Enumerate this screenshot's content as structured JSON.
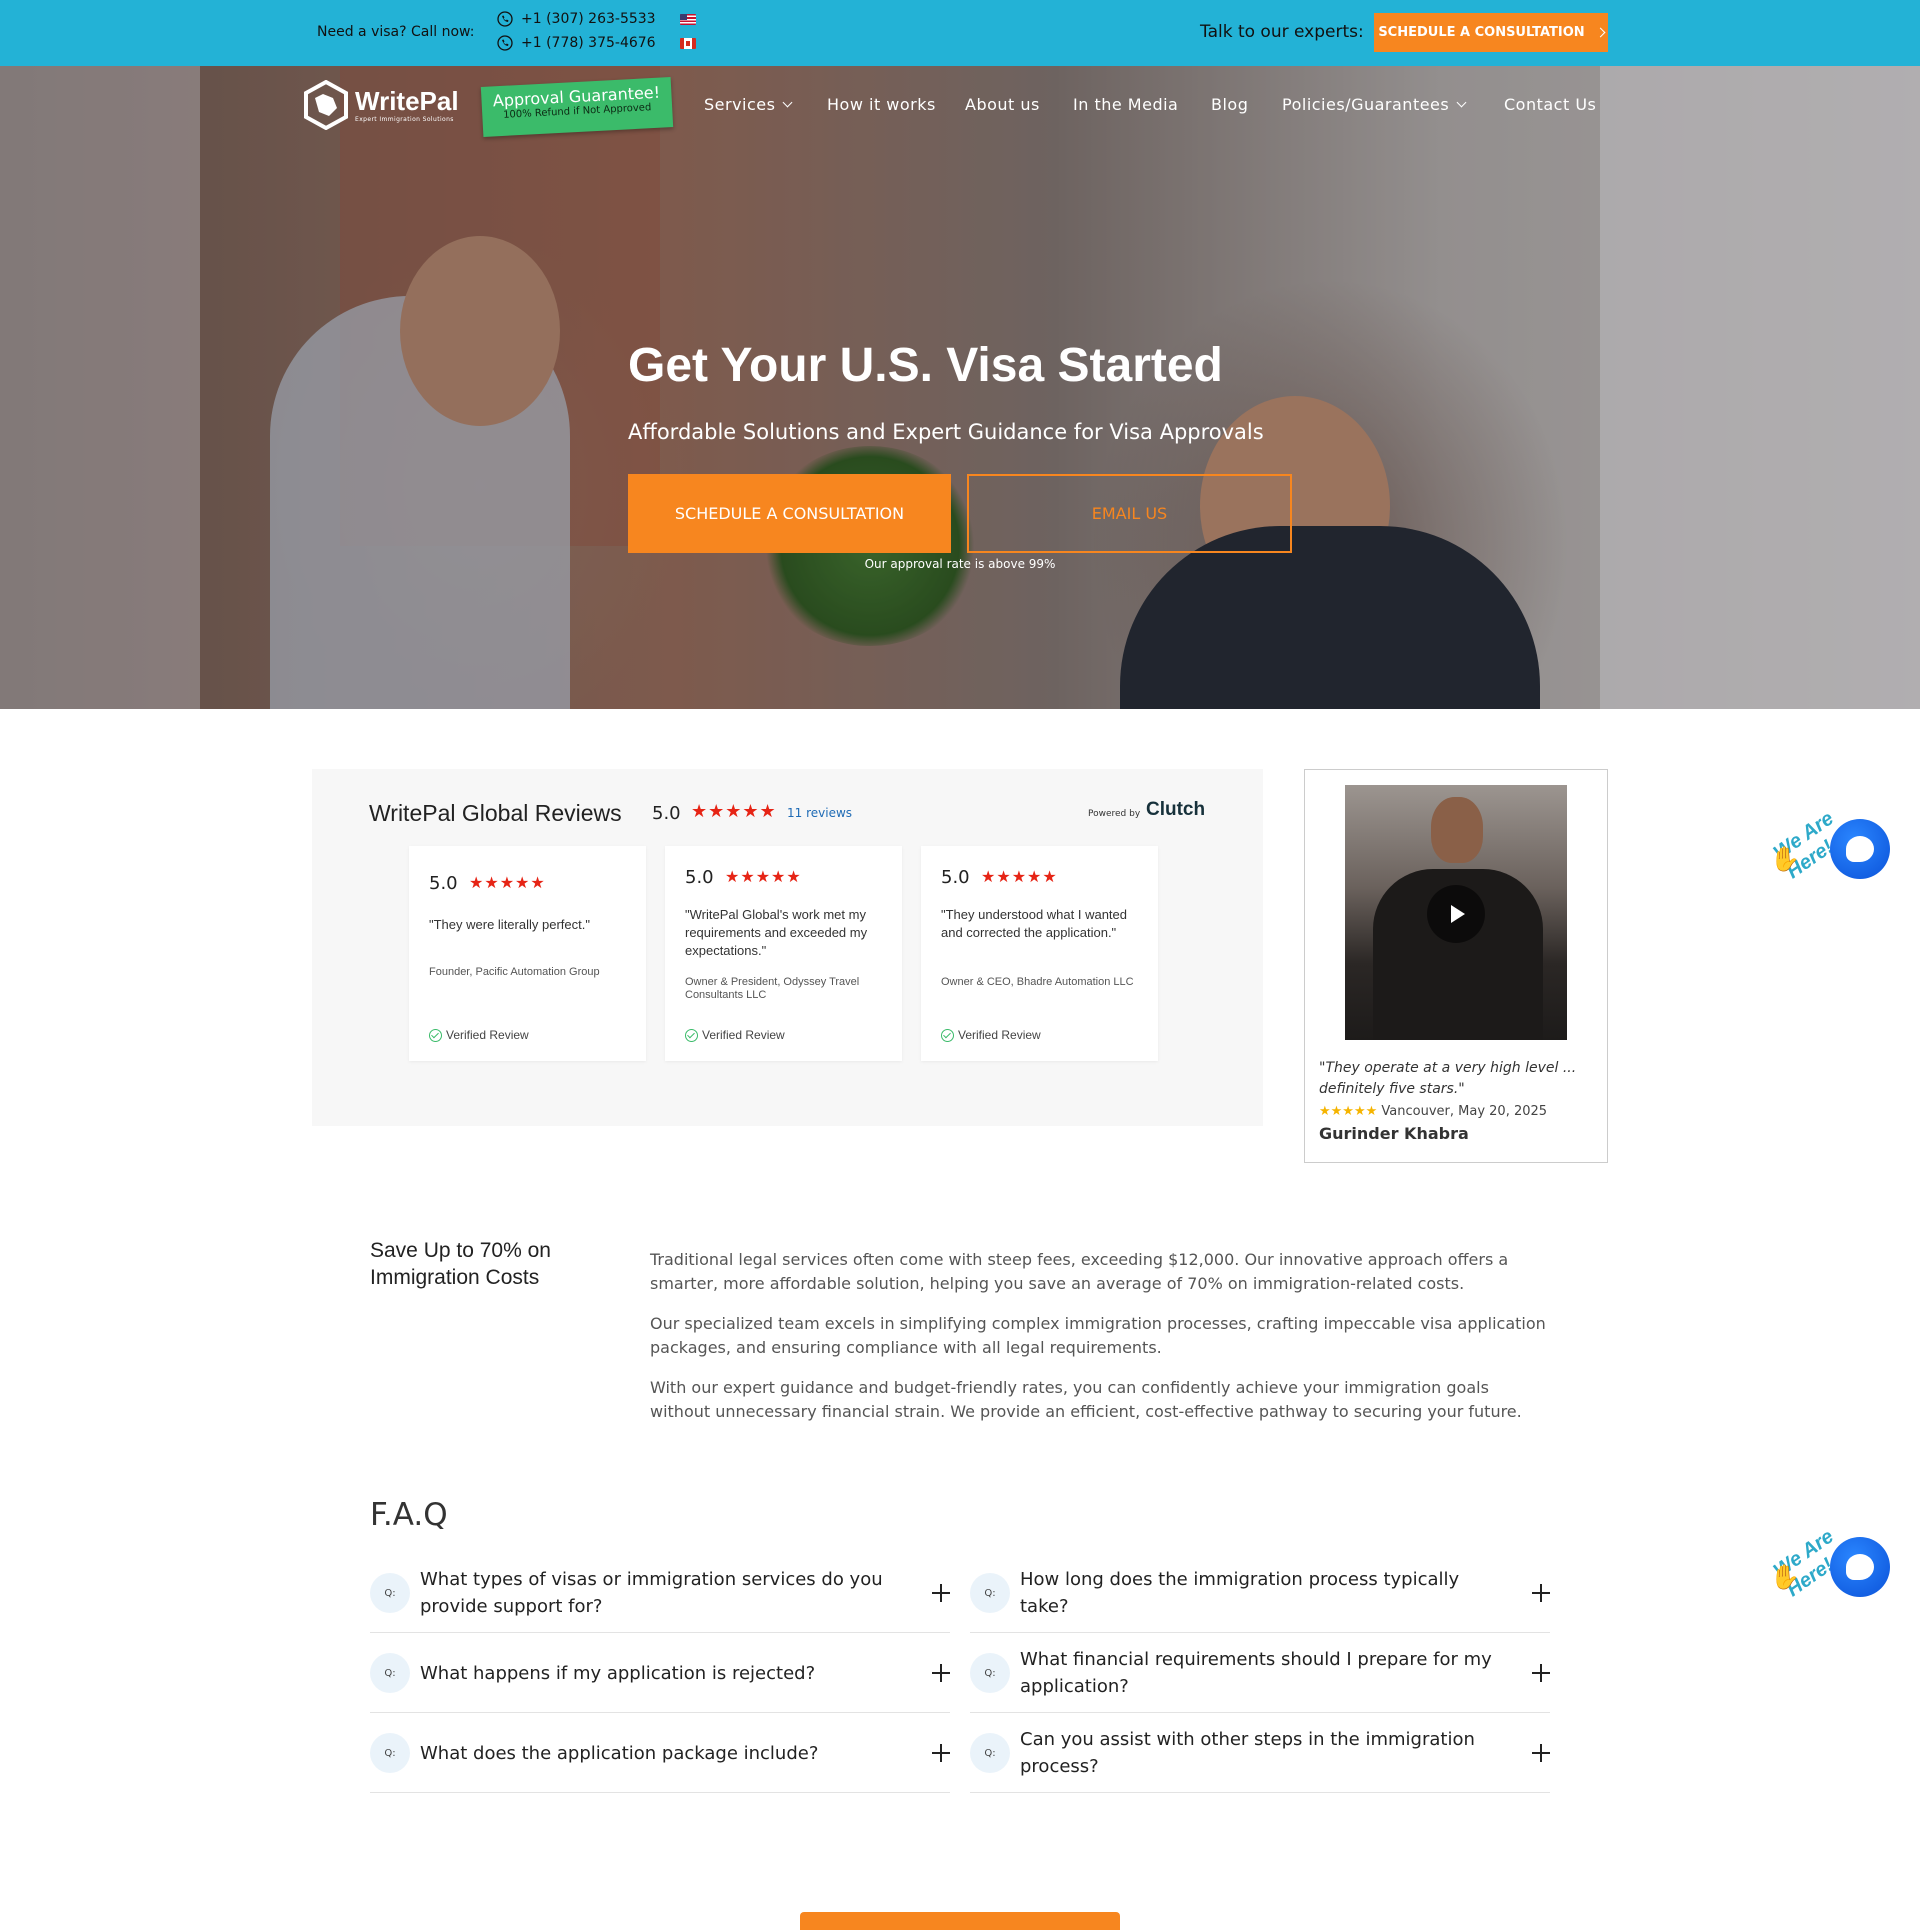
{
  "topbar": {
    "need_visa": "Need a visa? Call now:",
    "phone_us": "+1 (307) 263-5533",
    "phone_ca": "+1 (778) 375-4676",
    "talk": "Talk to our experts:",
    "cta": "SCHEDULE A CONSULTATION"
  },
  "header": {
    "logo_name": "WritePal",
    "logo_tagline": "Expert Immigration Solutions",
    "badge_title": "Approval Guarantee!",
    "badge_sub": "100% Refund if Not Approved",
    "nav": {
      "services": "Services",
      "how": "How it works",
      "about": "About us",
      "media": "In the Media",
      "blog": "Blog",
      "policies": "Policies/Guarantees",
      "contact": "Contact Us"
    }
  },
  "hero": {
    "title": "Get Your U.S. Visa Started",
    "subtitle": "Affordable Solutions and Expert Guidance for Visa Approvals",
    "btn_primary": "SCHEDULE A CONSULTATION",
    "btn_secondary": "EMAIL US",
    "note": "Our approval rate is above 99%"
  },
  "reviews": {
    "title": "WritePal Global Reviews",
    "score": "5.0",
    "stars": "★★★★★",
    "count": "11 reviews",
    "powered_by": "Powered by",
    "provider": "Clutch",
    "cards": [
      {
        "score": "5.0",
        "stars": "★★★★★",
        "quote": "\"They were literally perfect.\"",
        "who": "Founder, Pacific Automation Group",
        "verified": "Verified Review"
      },
      {
        "score": "5.0",
        "stars": "★★★★★",
        "quote": "\"WritePal Global's work met my requirements and exceeded my expectations.\"",
        "who": "Owner & President, Odyssey Travel Consultants LLC",
        "verified": "Verified Review"
      },
      {
        "score": "5.0",
        "stars": "★★★★★",
        "quote": "\"They understood what I wanted and corrected the application.\"",
        "who": "Owner & CEO, Bhadre Automation LLC",
        "verified": "Verified Review"
      }
    ]
  },
  "video_review": {
    "quote": "\"They operate at a very high level ... definitely five stars.\"",
    "stars": "★★★★★",
    "meta": "Vancouver, May 20, 2025",
    "name": "Gurinder Khabra"
  },
  "chat": {
    "label": "We Are Here!"
  },
  "save": {
    "title": "Save Up to 70% on Immigration Costs",
    "p1": "Traditional legal services often come with steep fees, exceeding $12,000. Our innovative approach offers a smarter, more affordable solution, helping you save an average of 70% on immigration-related costs.",
    "p2": "Our specialized team excels in simplifying complex immigration processes, crafting impeccable visa application packages, and ensuring compliance with all legal requirements.",
    "p3": "With our expert guidance and budget-friendly rates, you can confidently achieve your immigration goals without unnecessary financial strain. We provide an efficient, cost-effective pathway to securing your future."
  },
  "faq": {
    "title": "F.A.Q",
    "badge": "Q:",
    "items": [
      "What types of visas or immigration services do you provide support for?",
      "How long does the immigration process typically take?",
      "What happens if my application is rejected?",
      "What financial requirements should I prepare for my application?",
      "What does the application package include?",
      "Can you assist with other steps in the immigration process?"
    ]
  },
  "colors": {
    "topbar": "#23b2d6",
    "accent": "#f7861f",
    "badge": "#3bbb6a",
    "stars": "#e62415"
  }
}
